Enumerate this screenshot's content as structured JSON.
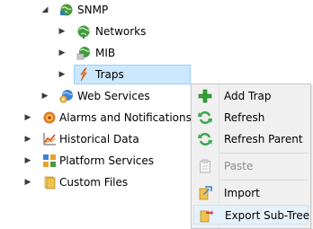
{
  "tree": {
    "snmp": {
      "label": "SNMP",
      "icon": "snmp-globe-icon",
      "expander": "expanded"
    },
    "networks": {
      "label": "Networks",
      "icon": "globe-icon",
      "expander": "collapsed"
    },
    "mib": {
      "label": "MIB",
      "icon": "mib-globe-icon",
      "expander": "collapsed"
    },
    "traps": {
      "label": "Traps",
      "icon": "lightning-icon",
      "expander": "collapsed",
      "selected": true
    },
    "web_services": {
      "label": "Web Services",
      "icon": "web-services-icon",
      "expander": "collapsed"
    },
    "alarms": {
      "label": "Alarms and Notifications",
      "icon": "alarm-icon",
      "expander": "collapsed"
    },
    "historical": {
      "label": "Historical Data",
      "icon": "chart-icon",
      "expander": "collapsed"
    },
    "platform": {
      "label": "Platform Services",
      "icon": "platform-icon",
      "expander": "collapsed"
    },
    "custom_files": {
      "label": "Custom Files",
      "icon": "files-icon",
      "expander": "collapsed"
    }
  },
  "context_menu": {
    "add_trap": {
      "label": "Add Trap",
      "icon": "plus-icon",
      "enabled": true
    },
    "refresh": {
      "label": "Refresh",
      "icon": "refresh-icon",
      "enabled": true
    },
    "refresh_parent": {
      "label": "Refresh Parent",
      "icon": "refresh-icon",
      "enabled": true
    },
    "paste": {
      "label": "Paste",
      "icon": "clipboard-icon",
      "enabled": false
    },
    "import": {
      "label": "Import",
      "icon": "import-icon",
      "enabled": true
    },
    "export_subtree": {
      "label": "Export Sub-Tree",
      "icon": "export-icon",
      "enabled": true,
      "highlighted": true
    }
  },
  "colors": {
    "selection_bg": "#cce8ff",
    "menu_bg": "#f0f0f0",
    "menu_hot_bg": "#e5f1fb",
    "refresh_green": "#3aa64a",
    "plus_green": "#33a333"
  }
}
